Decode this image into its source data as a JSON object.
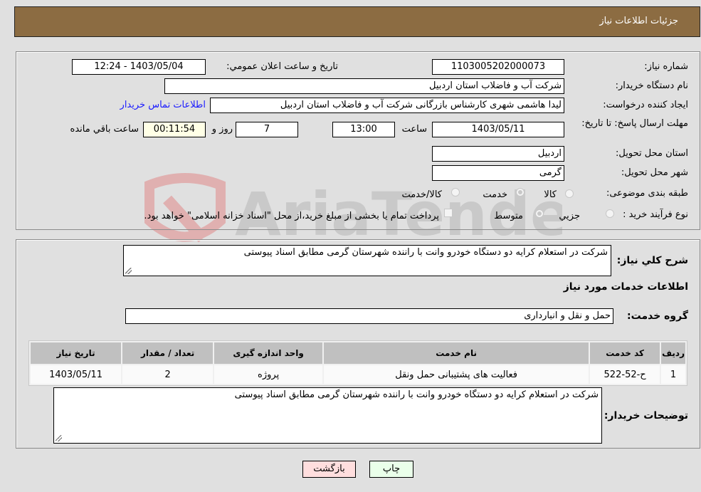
{
  "header": {
    "title": "جزئیات اطلاعات نیاز"
  },
  "details": {
    "need_number_label": "شماره نیاز:",
    "need_number": "1103005202000073",
    "announce_label": "تاریخ و ساعت اعلان عمومي:",
    "announce_value": "1403/05/04 - 12:24",
    "buyer_org_label": "نام دستگاه خریدار:",
    "buyer_org": "شرکت آب و فاضلاب استان اردبیل",
    "creator_label": "ایجاد کننده درخواست:",
    "creator": "لیدا  هاشمی شهری کارشناس بازرگانی شرکت آب و فاضلاب استان اردبیل",
    "contact_link": "اطلاعات تماس خریدار",
    "deadline_label": "مهلت ارسال پاسخ: تا تاریخ:",
    "deadline_date": "1403/05/11",
    "time_label": "ساعت",
    "deadline_time": "13:00",
    "days_value": "7",
    "days_label": "روز و",
    "remaining_value": "00:11:54",
    "remaining_label": "ساعت باقي مانده",
    "province_label": "استان محل تحویل:",
    "province": "اردبیل",
    "city_label": "شهر محل تحویل:",
    "city": "گرمی",
    "category_label": "طبقه بندی موضوعی:",
    "category_options": [
      {
        "label": "کالا",
        "checked": false
      },
      {
        "label": "خدمت",
        "checked": true
      },
      {
        "label": "کالا/خدمت",
        "checked": false
      }
    ],
    "process_label": "نوع فرآیند خرید :",
    "process_options": [
      {
        "label": "جزيي",
        "checked": false
      },
      {
        "label": "متوسط",
        "checked": true
      }
    ],
    "treasury_note": "پرداخت تمام یا بخشی از مبلغ خرید،از محل \"اسناد خزانه اسلامی\" خواهد بود.",
    "treasury_checked": false
  },
  "summary": {
    "general_desc_label": "شرح کلي نیاز:",
    "general_desc": "شرکت در استعلام کرایه دو دستگاه خودرو وانت با راننده شهرستان گرمی مطابق اسناد پیوستی",
    "services_heading": "اطلاعات خدمات مورد نیاز",
    "service_group_label": "گروه خدمت:",
    "service_group": "حمل و نقل و انبارداری"
  },
  "table": {
    "headers": [
      "ردیف",
      "کد خدمت",
      "نام خدمت",
      "واحد اندازه گیری",
      "تعداد / مقدار",
      "تاریخ نیاز"
    ],
    "rows": [
      [
        "1",
        "ح-52-522",
        "فعالیت های پشتیبانی حمل ونقل",
        "پروژه",
        "2",
        "1403/05/11"
      ]
    ]
  },
  "buyer_notes": {
    "label": "توضیحات خریدار:",
    "value": "شرکت در استعلام کرایه دو دستگاه خودرو وانت با راننده شهرستان گرمی مطابق اسناد پیوستی"
  },
  "buttons": {
    "print": "چاپ",
    "back": "بازگشت"
  },
  "colors": {
    "header_bg": "#8c6c42",
    "print_bg": "#eaffea",
    "back_bg": "#ffdede",
    "link": "#1a1aff"
  }
}
